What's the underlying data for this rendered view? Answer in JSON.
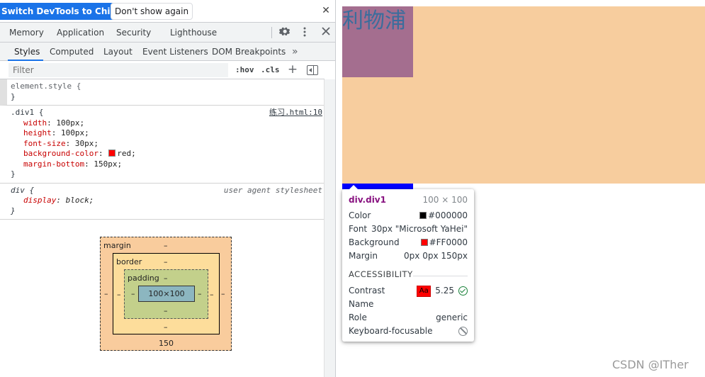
{
  "infobar": {
    "primary_label": "Switch DevTools to Chinese",
    "secondary_label": "Don't show again",
    "close_glyph": "✕",
    "primary_color": "#1a73e8"
  },
  "main_tabs": [
    "Memory",
    "Application",
    "Security",
    "Lighthouse"
  ],
  "toolbar_icons": [
    "gear-icon",
    "kebab-menu-icon",
    "close-icon"
  ],
  "sub_tabs": {
    "items": [
      "Styles",
      "Computed",
      "Layout",
      "Event Listeners",
      "DOM Breakpoints"
    ],
    "active": "Styles",
    "more": "»"
  },
  "filter": {
    "placeholder": "Filter",
    "hov": ":hov",
    "cls": ".cls",
    "plus": "+"
  },
  "rules": {
    "element_style": {
      "selector": "element.style {",
      "close": "}"
    },
    "div1": {
      "selector": ".div1 {",
      "source_file": "练习.html",
      "source_line": ":10",
      "decls": [
        {
          "prop": "width",
          "value": "100px;"
        },
        {
          "prop": "height",
          "value": "100px;"
        },
        {
          "prop": "font-size",
          "value": "30px;"
        },
        {
          "prop": "background-color",
          "value": "red;",
          "swatch": "#ff0000"
        },
        {
          "prop": "margin-bottom",
          "value": "150px;"
        }
      ],
      "close": "}"
    },
    "ua": {
      "selector": "div {",
      "source": "user agent stylesheet",
      "decl_prop": "display",
      "decl_value": "block;",
      "close": "}"
    }
  },
  "box_model": {
    "margin_label": "margin",
    "border_label": "border",
    "padding_label": "padding",
    "content": "100×100",
    "dash": "–",
    "margin_bottom": "150"
  },
  "page": {
    "div_text": "利物浦",
    "div_bg": "#a46e8f",
    "area_bg": "#f7cd9e",
    "strip_color": "#0000ff"
  },
  "tooltip": {
    "element": "div.div1",
    "dims": "100 × 100",
    "rows": [
      {
        "label": "Color",
        "value": "#000000",
        "swatch": "#000000"
      },
      {
        "label": "Font",
        "value": "30px \"Microsoft YaHei\""
      },
      {
        "label": "Background",
        "value": "#FF0000",
        "swatch": "#ff0000"
      },
      {
        "label": "Margin",
        "value": "0px 0px 150px"
      }
    ],
    "accessibility_heading": "ACCESSIBILITY",
    "contrast_label": "Contrast",
    "contrast_badge": "Aa",
    "contrast_value": "5.25",
    "name_label": "Name",
    "role_label": "Role",
    "role_value": "generic",
    "focusable_label": "Keyboard-focusable"
  },
  "watermark": "CSDN @ITher"
}
